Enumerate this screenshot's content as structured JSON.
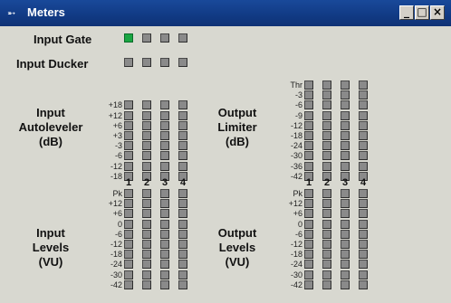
{
  "window": {
    "title": "Meters",
    "icon": "meters-window-icon",
    "controls": {
      "minimize": "_",
      "maximize": "□",
      "close": "×"
    }
  },
  "input_gate": {
    "label": "Input Gate",
    "leds": [
      true,
      false,
      false,
      false
    ]
  },
  "input_ducker": {
    "label": "Input Ducker",
    "leds": [
      false,
      false,
      false,
      false
    ]
  },
  "input_autoleveler": {
    "label": [
      "Input",
      "Autoleveler",
      "(dB)"
    ],
    "ticks": [
      "+18",
      "+12",
      "+6",
      "+3",
      "-3",
      "-6",
      "-12",
      "-18"
    ]
  },
  "output_limiter": {
    "label": [
      "Output",
      "Limiter",
      "(dB)"
    ],
    "ticks": [
      "Thr",
      "-3",
      "-6",
      "-9",
      "-12",
      "-18",
      "-24",
      "-30",
      "-36",
      "-42"
    ]
  },
  "channels": [
    "1",
    "2",
    "3",
    "4"
  ],
  "input_levels": {
    "label": [
      "Input",
      "Levels",
      "(VU)"
    ],
    "ticks": [
      "Pk",
      "+12",
      "+6",
      "0",
      "-6",
      "-12",
      "-18",
      "-24",
      "-30",
      "-42"
    ]
  },
  "output_levels": {
    "label": [
      "Output",
      "Levels",
      "(VU)"
    ],
    "ticks": [
      "Pk",
      "+12",
      "+6",
      "0",
      "-6",
      "-12",
      "-18",
      "-24",
      "-30",
      "-42"
    ]
  },
  "colors": {
    "led_off": "#8a8a8a",
    "led_on": "#19a642",
    "titlebar": "#113a84"
  }
}
